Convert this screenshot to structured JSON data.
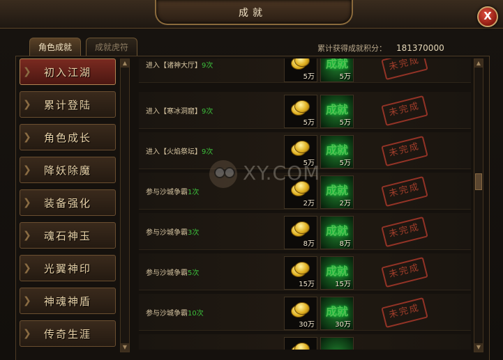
{
  "window": {
    "title": "成就",
    "close_label": "X"
  },
  "tabs": [
    {
      "label": "角色成就",
      "active": true
    },
    {
      "label": "成就虎符",
      "active": false
    }
  ],
  "summary": {
    "label": "累计获得成就积分：",
    "value": "181370000"
  },
  "sidebar": {
    "items": [
      {
        "label": "初入江湖",
        "active": true
      },
      {
        "label": "累计登陆",
        "active": false
      },
      {
        "label": "角色成长",
        "active": false
      },
      {
        "label": "降妖除魔",
        "active": false
      },
      {
        "label": "装备强化",
        "active": false
      },
      {
        "label": "魂石神玉",
        "active": false
      },
      {
        "label": "光翼神印",
        "active": false
      },
      {
        "label": "神魂神盾",
        "active": false
      },
      {
        "label": "传奇生涯",
        "active": false
      }
    ]
  },
  "achievements": [
    {
      "desc": "进入【诸神大厅】",
      "count": "9次",
      "gold": "5万",
      "points_label": "成就",
      "points": "5万",
      "status": "未完成"
    },
    {
      "desc": "进入【寒冰洞窟】",
      "count": "9次",
      "gold": "5万",
      "points_label": "成就",
      "points": "5万",
      "status": "未完成"
    },
    {
      "desc": "进入【火焰祭坛】",
      "count": "9次",
      "gold": "5万",
      "points_label": "成就",
      "points": "5万",
      "status": "未完成"
    },
    {
      "desc": "参与沙城争霸",
      "count": "1次",
      "gold": "2万",
      "points_label": "成就",
      "points": "2万",
      "status": "未完成"
    },
    {
      "desc": "参与沙城争霸",
      "count": "3次",
      "gold": "8万",
      "points_label": "成就",
      "points": "8万",
      "status": "未完成"
    },
    {
      "desc": "参与沙城争霸",
      "count": "5次",
      "gold": "15万",
      "points_label": "成就",
      "points": "15万",
      "status": "未完成"
    },
    {
      "desc": "参与沙城争霸",
      "count": "10次",
      "gold": "30万",
      "points_label": "成就",
      "points": "30万",
      "status": "未完成"
    }
  ],
  "watermark": {
    "text": "XY.COM"
  },
  "colors": {
    "accent_red": "#7a2a20",
    "count_green": "#3bbf3b",
    "stamp_red": "#b8442f",
    "gold": "#e0b020"
  }
}
